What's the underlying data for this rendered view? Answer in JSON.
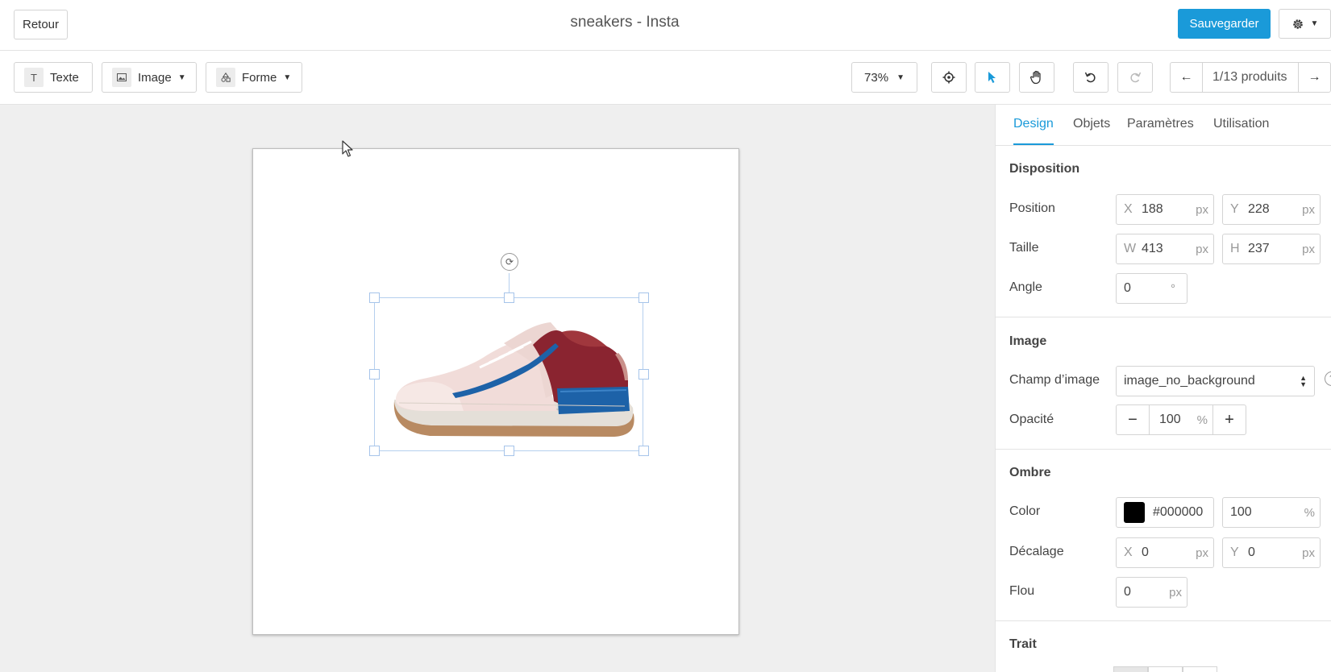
{
  "header": {
    "back_label": "Retour",
    "title": "sneakers - Insta",
    "save_label": "Sauvegarder",
    "settings_icon": "gear-icon"
  },
  "toolbar": {
    "text_label": "Texte",
    "image_label": "Image",
    "shape_label": "Forme",
    "zoom": "73%",
    "pager": "1/13 produits"
  },
  "panel": {
    "tabs": [
      "Design",
      "Objets",
      "Paramètres",
      "Utilisation"
    ],
    "active_tab": "Design",
    "disposition": {
      "title": "Disposition",
      "position_label": "Position",
      "x_prefix": "X",
      "x": "188",
      "y_prefix": "Y",
      "y": "228",
      "size_label": "Taille",
      "w_prefix": "W",
      "w": "413",
      "h_prefix": "H",
      "h": "237",
      "angle_label": "Angle",
      "angle": "0",
      "angle_unit": "°",
      "unit": "px"
    },
    "image": {
      "title": "Image",
      "field_label": "Champ d’image",
      "field_value": "image_no_background",
      "opacity_label": "Opacité",
      "opacity": "100",
      "opacity_unit": "%"
    },
    "shadow": {
      "title": "Ombre",
      "color_label": "Color",
      "color": "#000000",
      "color_opacity": "100",
      "color_opacity_unit": "%",
      "offset_label": "Décalage",
      "offset_x_prefix": "X",
      "offset_x": "0",
      "offset_y_prefix": "Y",
      "offset_y": "0",
      "blur_label": "Flou",
      "blur": "0",
      "unit": "px"
    },
    "stroke": {
      "title": "Trait"
    }
  },
  "colors": {
    "accent": "#1a9ad9",
    "canvas_bg": "#efefef",
    "selection": "#b5cfee",
    "shoe_body": "#f1dcd9",
    "shoe_heel": "#8a2430",
    "shoe_blue": "#1d62a8",
    "shoe_sole": "#b88a62"
  }
}
